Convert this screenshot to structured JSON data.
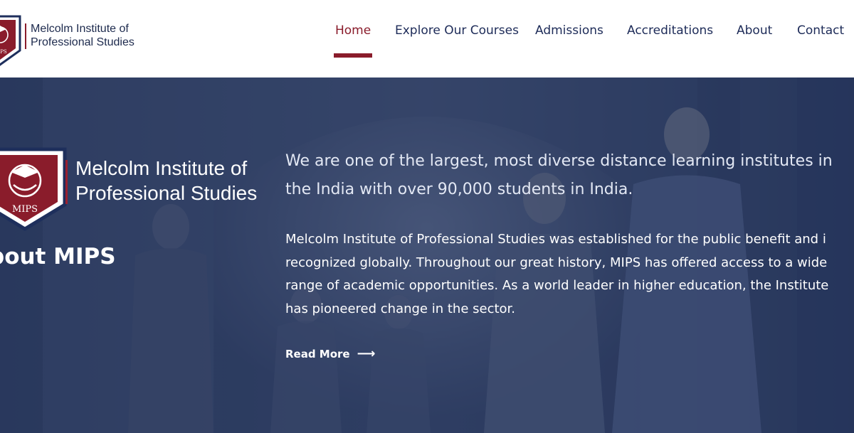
{
  "header": {
    "logo_name_line1": "Melcolm Institute of",
    "logo_name_line2": "Professional Studies",
    "logo_badge": "MIPS"
  },
  "nav": {
    "items": [
      {
        "label": "Home",
        "active": true
      },
      {
        "label": "Explore Our Courses",
        "active": false
      },
      {
        "label": "Admissions",
        "active": false
      },
      {
        "label": "Accreditations",
        "active": false
      },
      {
        "label": "About",
        "active": false
      },
      {
        "label": "Contact",
        "active": false
      }
    ]
  },
  "hero": {
    "logo_name_line1": "Melcolm Institute of",
    "logo_name_line2": "Professional Studies",
    "logo_badge": "MIPS",
    "about_title": "bout MIPS",
    "lead_line1": "We are one of the largest, most diverse distance learning institutes in",
    "lead_line2": "the India with over 90,000 students in India.",
    "body_line1": "Melcolm Institute of Professional Studies was established for the public benefit and i",
    "body_line2": "recognized globally. Throughout our great history, MIPS has offered access to a wide",
    "body_line3": "range of academic opportunities. As a world leader in higher education, the Institute",
    "body_line4": "has pioneered change in the sector.",
    "read_more": "Read More",
    "read_more_icon": "arrow-right-icon"
  },
  "colors": {
    "brand_red": "#8a1c2b",
    "navy": "#1d2b58",
    "hero_overlay": "#25345c"
  }
}
